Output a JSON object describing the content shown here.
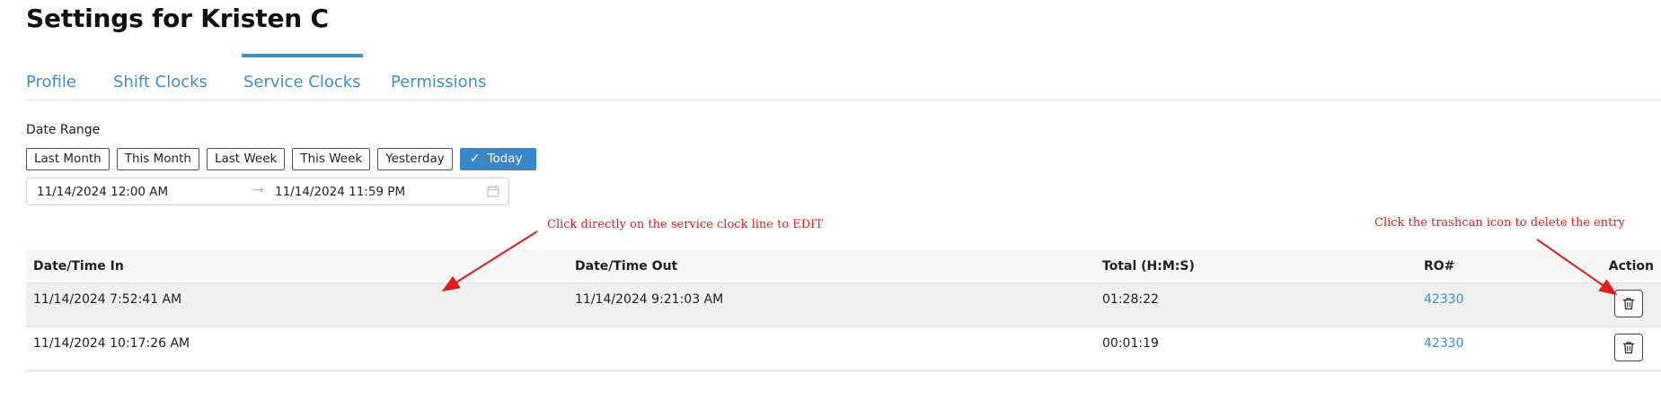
{
  "page": {
    "title": "Settings for Kristen C"
  },
  "tabs": [
    {
      "label": "Profile",
      "active": false
    },
    {
      "label": "Shift Clocks",
      "active": false
    },
    {
      "label": "Service Clocks",
      "active": true
    },
    {
      "label": "Permissions",
      "active": false
    }
  ],
  "date_range": {
    "label": "Date Range",
    "presets": [
      {
        "label": "Last Month",
        "active": false
      },
      {
        "label": "This Month",
        "active": false
      },
      {
        "label": "Last Week",
        "active": false
      },
      {
        "label": "This Week",
        "active": false
      },
      {
        "label": "Yesterday",
        "active": false
      },
      {
        "label": "Today",
        "active": true
      }
    ],
    "start": "11/14/2024 12:00 AM",
    "end": "11/14/2024 11:59 PM",
    "separator_icon": "arrow-right-icon",
    "calendar_icon": "calendar-icon"
  },
  "annotations": {
    "edit_hint": "Click directly on the service clock line to EDIT",
    "delete_hint": "Click the trashcan icon to delete the entry",
    "color": "#e01d1d"
  },
  "table": {
    "headers": {
      "date_in": "Date/Time In",
      "date_out": "Date/Time Out",
      "total": "Total (H:M:S)",
      "ro": "RO#",
      "action": "Action"
    },
    "rows": [
      {
        "date_in": "11/14/2024 7:52:41 AM",
        "date_out": "11/14/2024 9:21:03 AM",
        "total": "01:28:22",
        "ro": "42330",
        "action_icon": "trash-icon"
      },
      {
        "date_in": "11/14/2024 10:17:26 AM",
        "date_out": "",
        "total": "00:01:19",
        "ro": "42330",
        "action_icon": "trash-icon"
      }
    ]
  },
  "colors": {
    "accent": "#3f8fc4",
    "active_button": "#3a87c7",
    "row_hover": "#efefef"
  }
}
